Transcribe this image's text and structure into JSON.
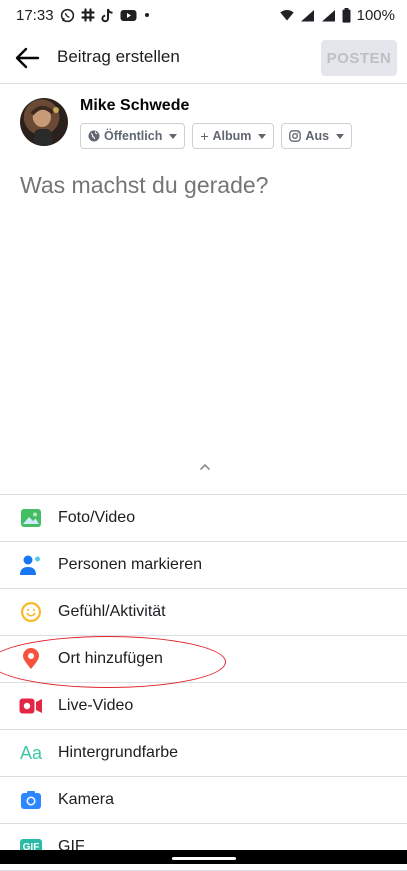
{
  "status_bar": {
    "time": "17:33",
    "battery": "100%"
  },
  "header": {
    "title": "Beitrag erstellen",
    "post_label": "POSTEN"
  },
  "user": {
    "name": "Mike Schwede",
    "chips": [
      {
        "label": "Öffentlich",
        "icon": "globe-icon"
      },
      {
        "label": "Album",
        "prefix": "+",
        "icon": "plus-icon"
      },
      {
        "label": "Aus",
        "icon": "instagram-icon"
      }
    ]
  },
  "composer": {
    "placeholder": "Was machst du gerade?"
  },
  "options": [
    {
      "label": "Foto/Video",
      "icon": "photo-video-icon",
      "color": "#45bd62"
    },
    {
      "label": "Personen markieren",
      "icon": "tag-people-icon",
      "color": "#1877f2"
    },
    {
      "label": "Gefühl/Aktivität",
      "icon": "feeling-icon",
      "color": "#f7b928"
    },
    {
      "label": "Ort hinzufügen",
      "icon": "location-pin-icon",
      "color": "#f5533d"
    },
    {
      "label": "Live-Video",
      "icon": "live-video-icon",
      "color": "#e42645"
    },
    {
      "label": "Hintergrundfarbe",
      "icon": "text-background-icon",
      "icon_text": "Aa",
      "color": "#3ec6a8"
    },
    {
      "label": "Kamera",
      "icon": "camera-icon",
      "color": "#2d88ff"
    },
    {
      "label": "GIF",
      "icon": "gif-icon",
      "icon_text": "GIF",
      "color": "#2abba7"
    }
  ],
  "annotation": {
    "color": "#e0262a",
    "target": "Ort hinzufügen"
  }
}
